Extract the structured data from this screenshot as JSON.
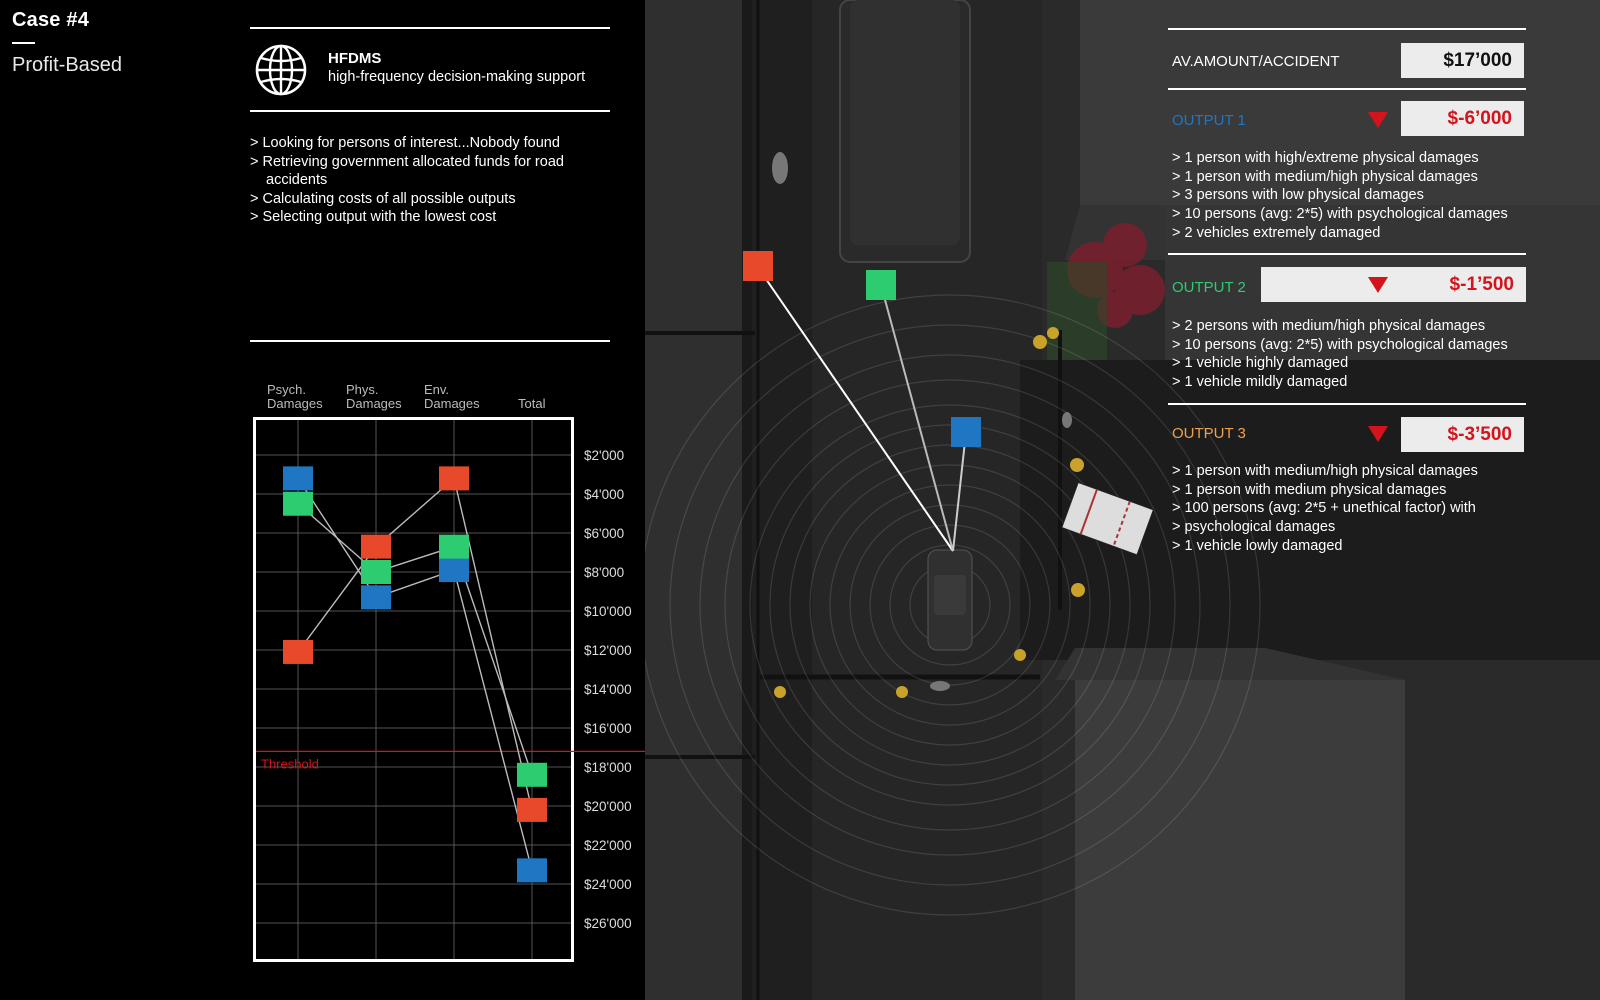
{
  "case": {
    "title": "Case #4",
    "mode": "Profit-Based"
  },
  "system": {
    "name": "HFDMS",
    "subtitle": "high-frequency decision-making support",
    "icon": "globe-icon"
  },
  "log": [
    "> Looking for persons of interest...Nobody found",
    "> Retrieving government allocated funds for road accidents",
    "> Calculating costs of all possible outputs",
    "> Selecting output with the lowest cost"
  ],
  "colors": {
    "output1": "#1f77c4",
    "output2": "#2ecc71",
    "output3": "#f0a04b",
    "chart_red": "#e8492a",
    "threshold": "#d4141c"
  },
  "chart_data": {
    "type": "scatter",
    "categories": [
      "Psych.\nDamages",
      "Phys.\nDamages",
      "Env.\nDamages",
      "Total"
    ],
    "y_ticks": [
      "$2'000",
      "$4'000",
      "$6'000",
      "$8'000",
      "$10'000",
      "$12'000",
      "$14'000",
      "$16'000",
      "$18'000",
      "$20'000",
      "$22'000",
      "$24'000",
      "$26'000"
    ],
    "ylim": [
      0,
      28000
    ],
    "y_inverted": true,
    "threshold": {
      "label": "Threshold",
      "value": 17200
    },
    "series": [
      {
        "color": "#1f77c4",
        "values": [
          3200,
          9300,
          7900,
          23300
        ]
      },
      {
        "color": "#2ecc71",
        "values": [
          4500,
          8000,
          6700,
          18400
        ]
      },
      {
        "color": "#e8492a",
        "values": [
          12100,
          6700,
          3200,
          20200
        ]
      }
    ]
  },
  "outputs_panel": {
    "av_label": "AV.AMOUNT/ACCIDENT",
    "av_value": "$17’000",
    "outputs": [
      {
        "label": "OUTPUT 1",
        "value": "$-6’000",
        "items": [
          "> 1 person with high/extreme physical damages",
          "> 1 person with medium/high physical damages",
          "> 3 persons with low physical damages",
          "> 10 persons (avg: 2*5) with psychological damages",
          "> 2 vehicles extremely damaged"
        ]
      },
      {
        "label": "OUTPUT 2",
        "value": "$-1’500",
        "items": [
          "> 2 persons with medium/high physical damages",
          "> 10 persons (avg: 2*5) with psychological damages",
          "> 1 vehicle highly damaged",
          "> 1 vehicle mildly damaged"
        ]
      },
      {
        "label": "OUTPUT 3",
        "value": "$-3’500",
        "items": [
          "> 1 person with medium/high physical damages",
          "> 1 person with medium physical damages",
          "> 100 persons (avg: 2*5 +  unethical factor) with",
          "> psychological damages",
          "> 1 vehicle lowly damaged"
        ]
      }
    ]
  }
}
